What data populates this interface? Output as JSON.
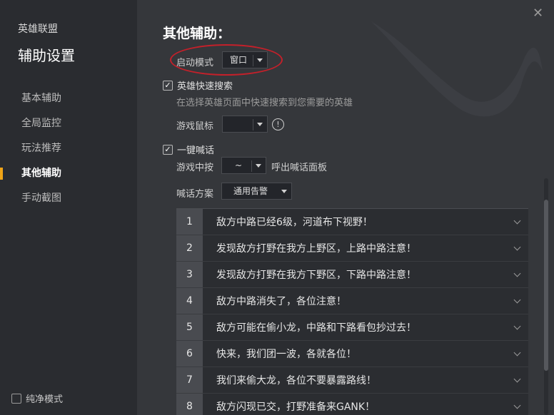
{
  "sidebar": {
    "app_name": "英雄联盟",
    "title": "辅助设置",
    "items": [
      {
        "label": "基本辅助"
      },
      {
        "label": "全局监控"
      },
      {
        "label": "玩法推荐"
      },
      {
        "label": "其他辅助"
      },
      {
        "label": "手动截图"
      }
    ],
    "pure_mode_label": "纯净模式"
  },
  "main": {
    "title": "其他辅助：",
    "launch_mode": {
      "label": "启动模式",
      "value": "窗口"
    },
    "hero_search": {
      "label": "英雄快速搜索",
      "checked": true,
      "description": "在选择英雄页面中快速搜索到您需要的英雄"
    },
    "game_mouse": {
      "label": "游戏鼠标",
      "value": ""
    },
    "one_key_shout": {
      "label": "一键喊话",
      "checked": true
    },
    "in_game_press": {
      "label": "游戏中按",
      "key": "~",
      "suffix": "呼出喊话面板"
    },
    "shout_scheme": {
      "label": "喊话方案",
      "value": "通用告警"
    },
    "messages": [
      {
        "num": "1",
        "text": "敌方中路已经6级，河道布下视野！"
      },
      {
        "num": "2",
        "text": "发现敌方打野在我方上野区，上路中路注意！"
      },
      {
        "num": "3",
        "text": "发现敌方打野在我方下野区，下路中路注意！"
      },
      {
        "num": "4",
        "text": "敌方中路消失了，各位注意！"
      },
      {
        "num": "5",
        "text": "敌方可能在偷小龙，中路和下路看包抄过去！"
      },
      {
        "num": "6",
        "text": "快来，我们团一波，各就各位！"
      },
      {
        "num": "7",
        "text": "我们来偷大龙，各位不要暴露路线！"
      },
      {
        "num": "8",
        "text": "敌方闪现已交，打野准备来GANK！"
      }
    ]
  },
  "colors": {
    "accent": "#f0a417",
    "highlight": "#c4202a"
  },
  "icons": {
    "close": "close-icon",
    "info": "info-icon",
    "check": "check-icon",
    "chevron": "chevron-down-icon"
  }
}
